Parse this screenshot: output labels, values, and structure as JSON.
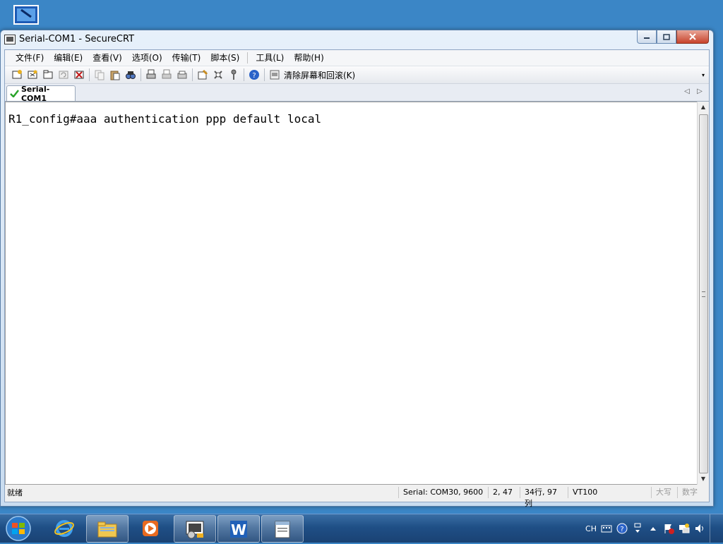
{
  "window": {
    "title": "Serial-COM1 - SecureCRT"
  },
  "menu": [
    "文件(F)",
    "编辑(E)",
    "查看(V)",
    "选项(O)",
    "传输(T)",
    "脚本(S)",
    "工具(L)",
    "帮助(H)"
  ],
  "toolbar": {
    "clear_screen_label": "清除屏幕和回滚(K)",
    "icons": [
      "connect-icon",
      "quick-connect-icon",
      "connect-tab-icon",
      "reconnect-icon",
      "disconnect-icon",
      "copy-icon",
      "paste-icon",
      "find-icon",
      "print-icon",
      "print-selection-icon",
      "print-setup-icon",
      "session-options-icon",
      "global-options-icon",
      "keymap-icon",
      "help-icon",
      "clear-screen-icon"
    ]
  },
  "tab": {
    "label": "Serial-COM1"
  },
  "terminal": {
    "line": "R1_config#aaa authentication ppp default local"
  },
  "status": {
    "ready": "就绪",
    "connection": "Serial: COM30, 9600",
    "cursor": "2,  47",
    "size": "34行, 97列",
    "emulation": "VT100",
    "caps": "大写",
    "num": "数字"
  },
  "tray": {
    "language": "CH"
  },
  "colors": {
    "desktop": "#3b86c6",
    "taskbar": "#1f4f86",
    "close": "#c7432c"
  }
}
